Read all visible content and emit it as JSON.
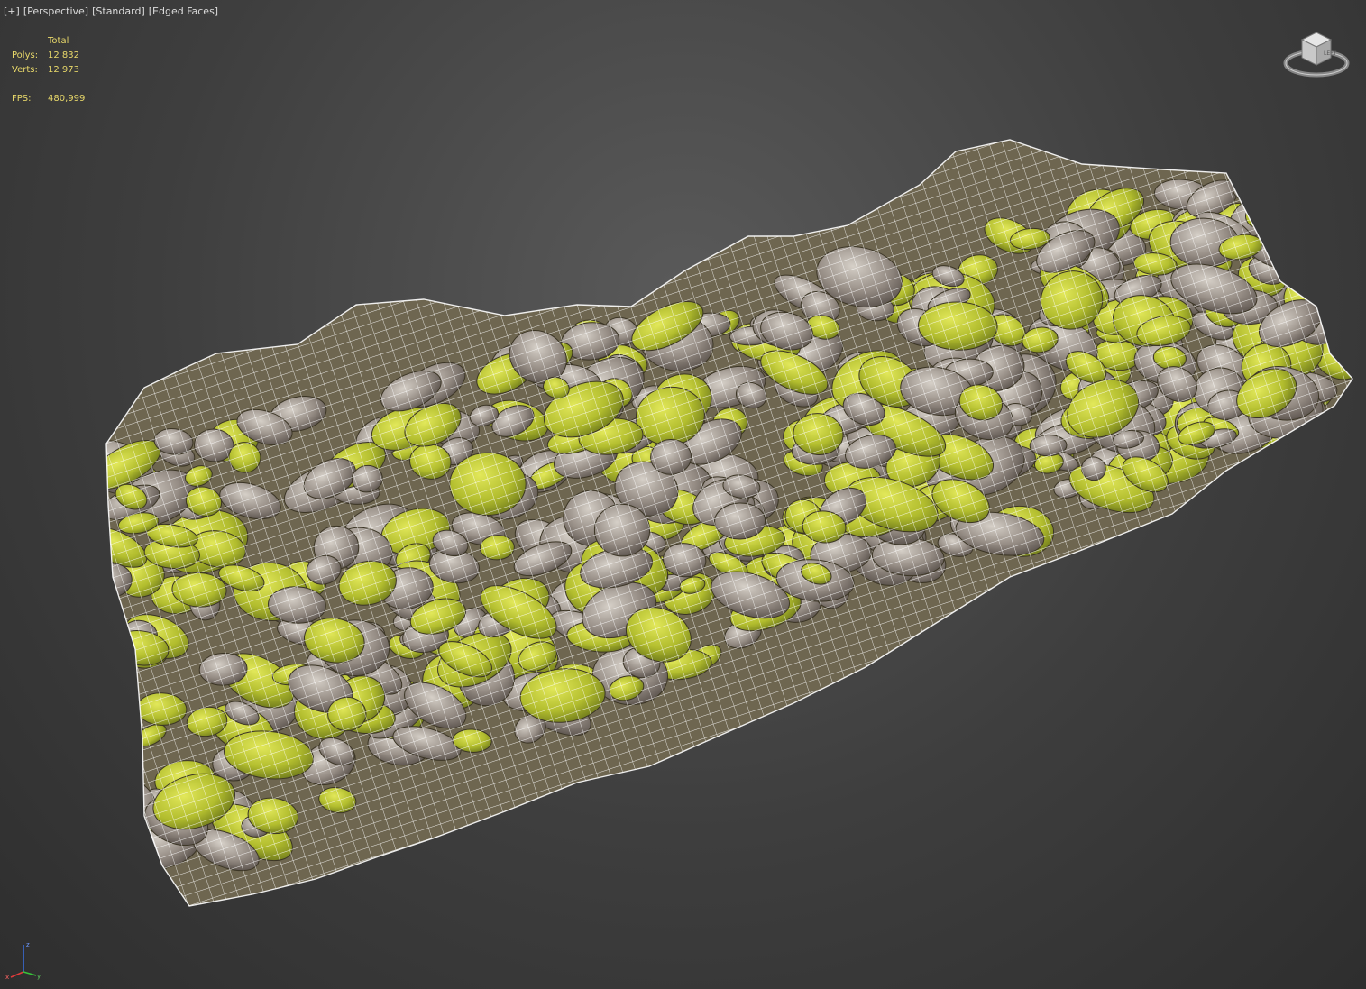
{
  "viewport": {
    "labels": [
      "[+]",
      "[Perspective]",
      "[Standard]",
      "[Edged Faces]"
    ]
  },
  "stats": {
    "header": "Total",
    "polys_label": "Polys:",
    "polys_value": "12 832",
    "verts_label": "Verts:",
    "verts_value": "12 973",
    "fps_label": "FPS:",
    "fps_value": "480,999"
  },
  "viewcube": {
    "label": "LEFT"
  },
  "colors": {
    "stats_text": "#e8d86a",
    "moss": "#b8c53a",
    "stone": "#9a9490",
    "wire": "#ffffff"
  }
}
